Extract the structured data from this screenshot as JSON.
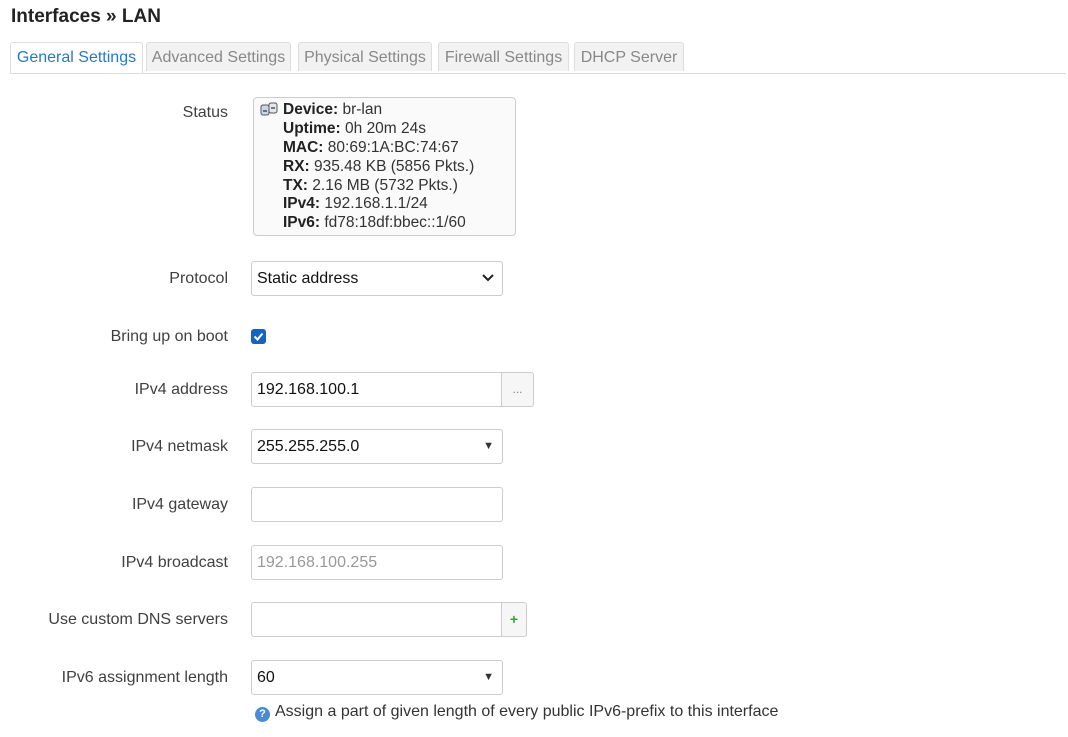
{
  "page": {
    "title": "Interfaces » LAN"
  },
  "tabs": [
    {
      "label": "General Settings",
      "active": true
    },
    {
      "label": "Advanced Settings"
    },
    {
      "label": "Physical Settings"
    },
    {
      "label": "Firewall Settings"
    },
    {
      "label": "DHCP Server"
    }
  ],
  "status": {
    "label": "Status",
    "icon": "network-icon",
    "device_key": "Device:",
    "device": "br-lan",
    "uptime_key": "Uptime:",
    "uptime": "0h 20m 24s",
    "mac_key": "MAC:",
    "mac": "80:69:1A:BC:74:67",
    "rx_key": "RX:",
    "rx": "935.48 KB (5856 Pkts.)",
    "tx_key": "TX:",
    "tx": "2.16 MB (5732 Pkts.)",
    "ipv4_key": "IPv4:",
    "ipv4": "192.168.1.1/24",
    "ipv6_key": "IPv6:",
    "ipv6": "fd78:18df:bbec::1/60"
  },
  "protocol": {
    "label": "Protocol",
    "value": "Static address"
  },
  "boot": {
    "label": "Bring up on boot",
    "checked": true
  },
  "ipv4_address": {
    "label": "IPv4 address",
    "value": "192.168.100.1",
    "button": "..."
  },
  "ipv4_netmask": {
    "label": "IPv4 netmask",
    "value": "255.255.255.0"
  },
  "ipv4_gateway": {
    "label": "IPv4 gateway",
    "value": ""
  },
  "ipv4_broadcast": {
    "label": "IPv4 broadcast",
    "placeholder": "192.168.100.255"
  },
  "dns": {
    "label": "Use custom DNS servers",
    "value": "",
    "button": "+"
  },
  "ipv6_assign": {
    "label": "IPv6 assignment length",
    "value": "60",
    "help_icon": "?",
    "help": "Assign a part of given length of every public IPv6-prefix to this interface"
  },
  "colors": {
    "accent": "#1f7bc9",
    "checkbox": "#1565c0",
    "add": "#3aa23a"
  }
}
